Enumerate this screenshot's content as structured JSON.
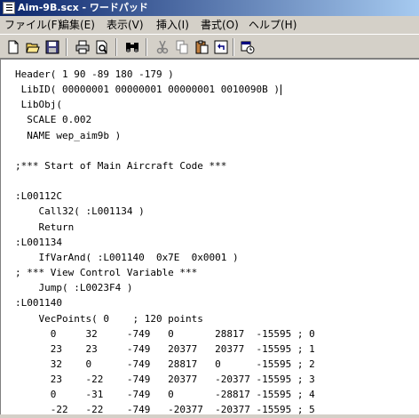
{
  "window": {
    "title": "Aim-9B.scx - ワードパッド"
  },
  "menu": [
    "ファイル(F)",
    "編集(E)",
    "表示(V)",
    "挿入(I)",
    "書式(O)",
    "ヘルプ(H)"
  ],
  "toolbar": {
    "buttons": [
      "new-document",
      "open",
      "save",
      "print",
      "print-preview",
      "find",
      "cut",
      "copy",
      "paste",
      "undo",
      "insert-date-time"
    ]
  },
  "document": {
    "lines": [
      "Header( 1 90 -89 180 -179 )",
      " LibID( 00000001 00000001 00000001 0010090B )",
      " LibObj(",
      "  SCALE 0.002",
      "  NAME wep_aim9b )",
      "",
      ";*** Start of Main Aircraft Code ***",
      "",
      ":L00112C",
      "    Call32( :L001134 )",
      "    Return",
      ":L001134",
      "    IfVarAnd( :L001140  0x7E  0x0001 )",
      "; *** View Control Variable ***",
      "    Jump( :L0023F4 )",
      ":L001140",
      "    VecPoints( 0    ; 120 points",
      "      0     32     -749   0       28817  -15595 ; 0",
      "      23    23     -749   20377   20377  -15595 ; 1",
      "      32    0      -749   28817   0      -15595 ; 2",
      "      23    -22    -749   20377   -20377 -15595 ; 3",
      "      0     -31    -749   0       -28817 -15595 ; 4",
      "      -22   -22    -749   -20377  -20377 -15595 ; 5"
    ]
  }
}
